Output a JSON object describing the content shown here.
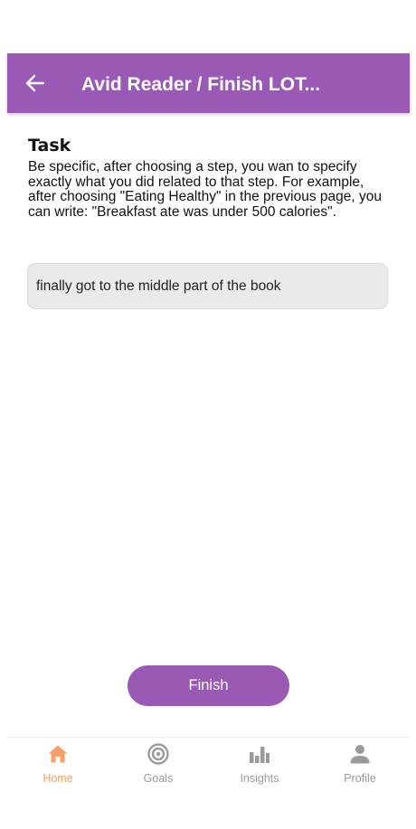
{
  "header": {
    "title": "Avid Reader / Finish LOT...",
    "back_icon": "arrow-left-icon",
    "background_color": "#9b59b6"
  },
  "task": {
    "heading": "Task",
    "description": "Be specific, after choosing a step, you wan to specify exactly what you did related to that step. For example, after choosing \"Eating Healthy\" in the previous page, you can write: \"Breakfast ate was under 500 calories\".",
    "input_value": "finally got to the middle part of the book"
  },
  "actions": {
    "finish_label": "Finish"
  },
  "bottom_nav": {
    "active_color": "#f5a06b",
    "inactive_color": "#9a9a9a",
    "items": [
      {
        "label": "Home",
        "icon": "home-icon",
        "active": true
      },
      {
        "label": "Goals",
        "icon": "target-icon",
        "active": false
      },
      {
        "label": "Insights",
        "icon": "bar-chart-icon",
        "active": false
      },
      {
        "label": "Profile",
        "icon": "person-icon",
        "active": false
      }
    ]
  }
}
